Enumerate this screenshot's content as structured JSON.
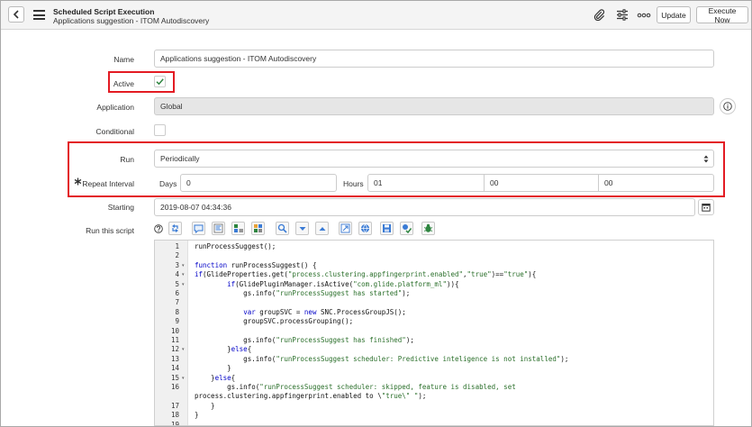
{
  "header": {
    "title": "Scheduled Script Execution",
    "subtitle": "Applications suggestion - ITOM Autodiscovery",
    "update_label": "Update",
    "execute_label": "Execute Now",
    "icons": [
      "back-icon",
      "hamburger-icon",
      "paperclip-icon",
      "sliders-icon",
      "more-icon"
    ]
  },
  "form": {
    "name_label": "Name",
    "name_value": "Applications suggestion - ITOM Autodiscovery",
    "active_label": "Active",
    "active_checked": true,
    "application_label": "Application",
    "application_value": "Global",
    "conditional_label": "Conditional",
    "conditional_checked": false,
    "run_label": "Run",
    "run_value": "Periodically",
    "repeat_label": "Repeat Interval",
    "days_label": "Days",
    "days_value": "0",
    "hours_label": "Hours",
    "hours_value": "01",
    "minutes_value": "00",
    "seconds_value": "00",
    "starting_label": "Starting",
    "starting_value": "2019-08-07 04:34:36",
    "script_label": "Run this script"
  },
  "script_lines": [
    {
      "n": "1",
      "text": "runProcessSuggest();",
      "fold": false
    },
    {
      "n": "2",
      "text": "",
      "fold": false
    },
    {
      "n": "3",
      "text": "function runProcessSuggest() {",
      "fold": true
    },
    {
      "n": "4",
      "text": "if(GlideProperties.get(\"process.clustering.appfingerprint.enabled\",\"true\")==\"true\"){",
      "fold": true
    },
    {
      "n": "5",
      "text": "        if(GlidePluginManager.isActive(\"com.glide.platform_ml\")){",
      "fold": true
    },
    {
      "n": "6",
      "text": "            gs.info(\"runProcessSuggest has started\");",
      "fold": false
    },
    {
      "n": "7",
      "text": "",
      "fold": false
    },
    {
      "n": "8",
      "text": "            var groupSVC = new SNC.ProcessGroupJS();",
      "fold": false
    },
    {
      "n": "9",
      "text": "            groupSVC.processGrouping();",
      "fold": false
    },
    {
      "n": "10",
      "text": "",
      "fold": false
    },
    {
      "n": "11",
      "text": "            gs.info(\"runProcessSuggest has finished\");",
      "fold": false
    },
    {
      "n": "12",
      "text": "        }else{",
      "fold": true
    },
    {
      "n": "13",
      "text": "            gs.info(\"runProcessSuggest scheduler: Predictive inteligence is not installed\");",
      "fold": false
    },
    {
      "n": "14",
      "text": "        }",
      "fold": false
    },
    {
      "n": "15",
      "text": "    }else{",
      "fold": true
    },
    {
      "n": "16",
      "text": "        gs.info(\"runProcessSuggest scheduler: skipped, feature is disabled, set",
      "fold": false
    },
    {
      "n": "",
      "text": "process.clustering.appfingerprint.enabled to \\\"true\\\" \");",
      "fold": false
    },
    {
      "n": "17",
      "text": "    }",
      "fold": false
    },
    {
      "n": "18",
      "text": "}",
      "fold": false
    },
    {
      "n": "19",
      "text": "",
      "fold": false
    }
  ],
  "colors": {
    "highlight_border": "#e31b23",
    "readonly_bg": "#e6e6e6",
    "check": "#2e8540"
  }
}
